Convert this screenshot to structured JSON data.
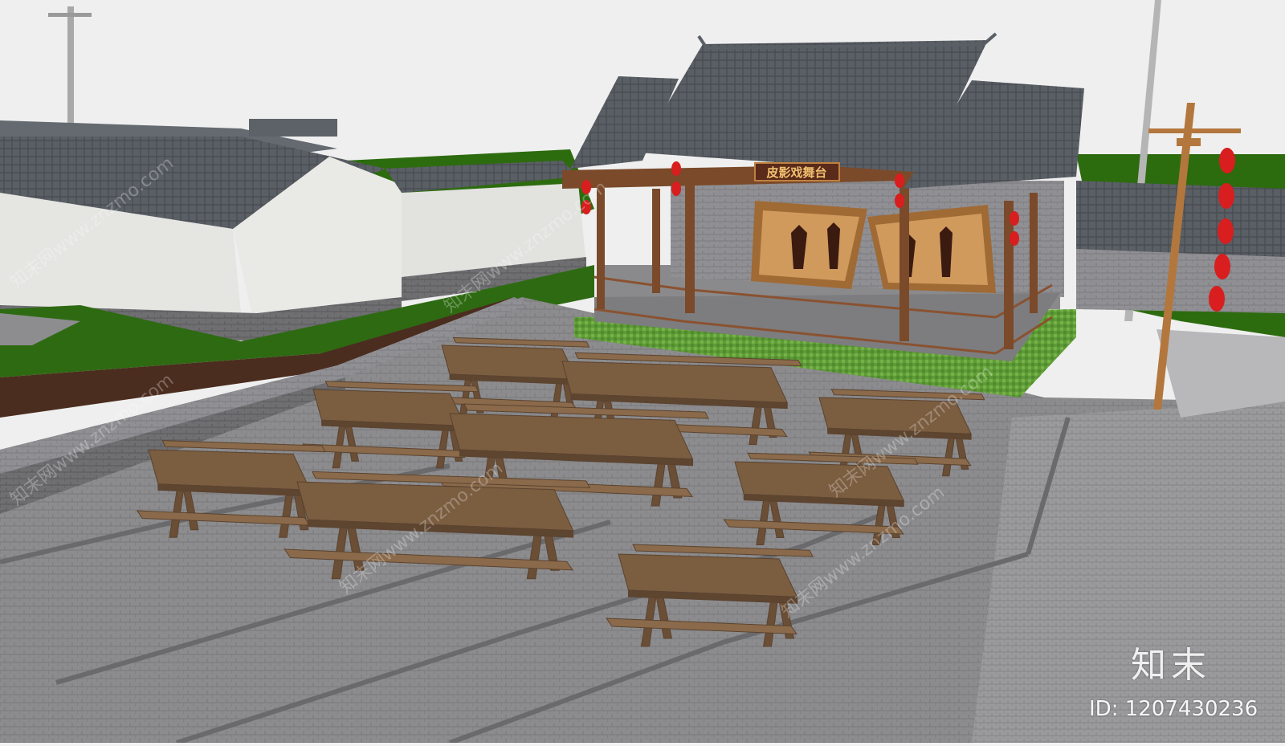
{
  "stage_sign": "皮影戏舞台",
  "watermark": {
    "logo_text": "知末",
    "id_text": "ID: 1207430236",
    "site_text": "知末网www.znzmo.com"
  },
  "palette": {
    "sky": "#f2f2f2",
    "grass": "#2d6b0f",
    "roof_tile": "#555a60",
    "plaster": "#e7e7e4",
    "brick": "#6e6e70",
    "paving": "#8a8a8c",
    "timber": "#7a4a2a",
    "lantern": "#d81e1e",
    "table_wood": "#7b5d40"
  }
}
